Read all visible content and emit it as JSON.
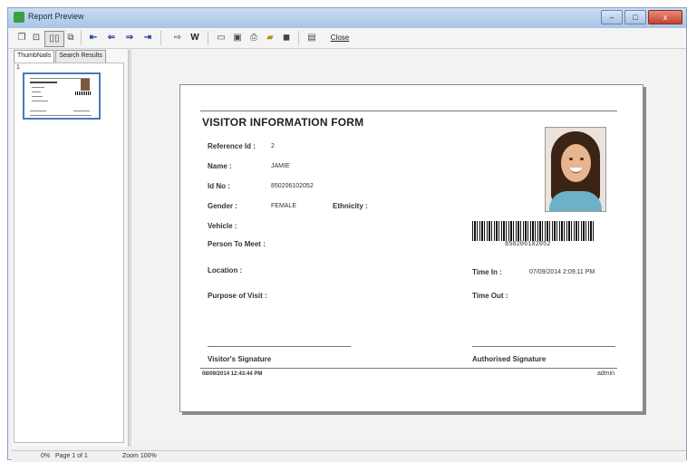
{
  "window": {
    "title": "Report Preview",
    "close_label": "x"
  },
  "toolbar": {
    "close_label": "Close",
    "w_label": "W"
  },
  "left_panel": {
    "tabs": [
      "ThumbNails",
      "Search Results"
    ],
    "thumb_number": "1"
  },
  "report": {
    "title": "VISITOR INFORMATION FORM",
    "reference_label": "Reference Id :",
    "reference_value": "2",
    "name_label": "Name :",
    "name_value": "JAMIE",
    "idno_label": "Id No :",
    "idno_value": "850206102052",
    "gender_label": "Gender :",
    "gender_value": "FEMALE",
    "ethnicity_label": "Ethnicity :",
    "vehicle_label": "Vehicle :",
    "person_label": "Person To Meet :",
    "location_label": "Location :",
    "time_in_label": "Time In :",
    "time_in_value": "07/09/2014 2:09:11 PM",
    "purpose_label": "Purpose of Visit :",
    "time_out_label": "Time Out :",
    "barcode_text": "850206102052",
    "visitor_signature": "Visitor's Signature",
    "authorised_signature": "Authorised Signature",
    "footer_timestamp": "08/09/2014 12:43:44 PM",
    "footer_user": "admin"
  },
  "status": {
    "progress": "0%",
    "page": "Page 1 of 1",
    "zoom": "Zoom 100%"
  },
  "icons": {
    "nav_arrow_color": "#1f3d99"
  }
}
